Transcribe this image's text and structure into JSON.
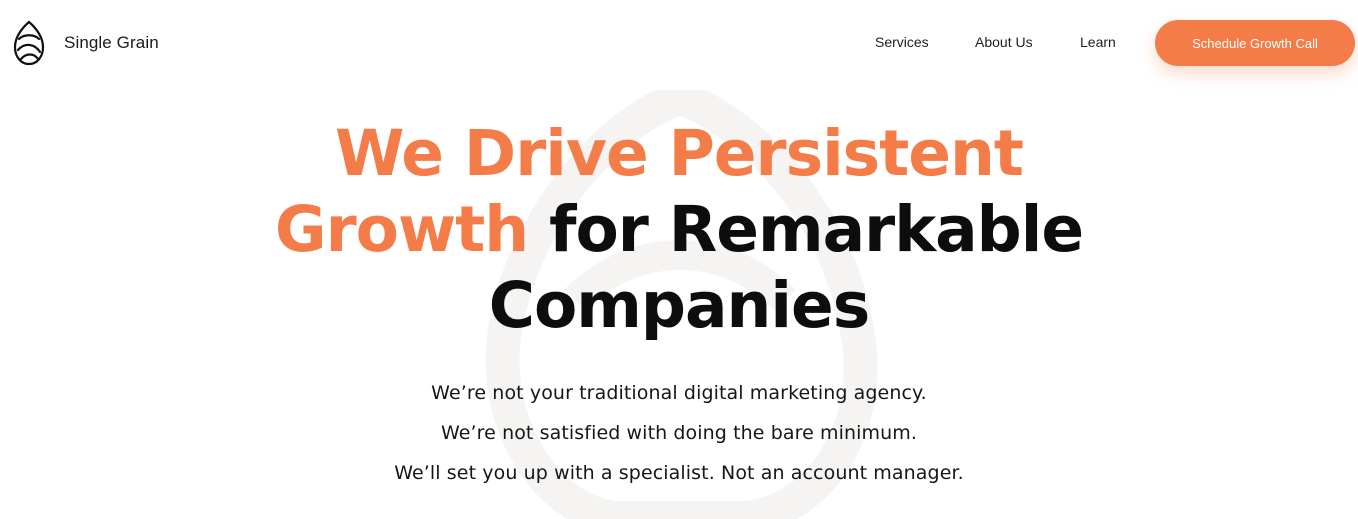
{
  "brand": {
    "name": "Single Grain"
  },
  "nav": {
    "items": [
      {
        "label": "Services"
      },
      {
        "label": "About Us"
      },
      {
        "label": "Learn"
      }
    ],
    "cta_label": "Schedule Growth Call"
  },
  "hero": {
    "headline_line1": "We Drive Persistent",
    "headline_line2_accent": "Growth",
    "headline_line2_rest": " for Remarkable",
    "headline_line3": "Companies",
    "sub_lines": [
      "We’re not your traditional digital marketing agency.",
      "We’re not satisfied with doing the bare minimum.",
      "We’ll set you up with a specialist. Not an account manager."
    ]
  },
  "colors": {
    "accent": "#f47c48",
    "text": "#0d0d0d",
    "background": "#ffffff"
  },
  "icons": {
    "logo": "single-grain-logo-icon",
    "watermark": "background-grain-watermark"
  }
}
